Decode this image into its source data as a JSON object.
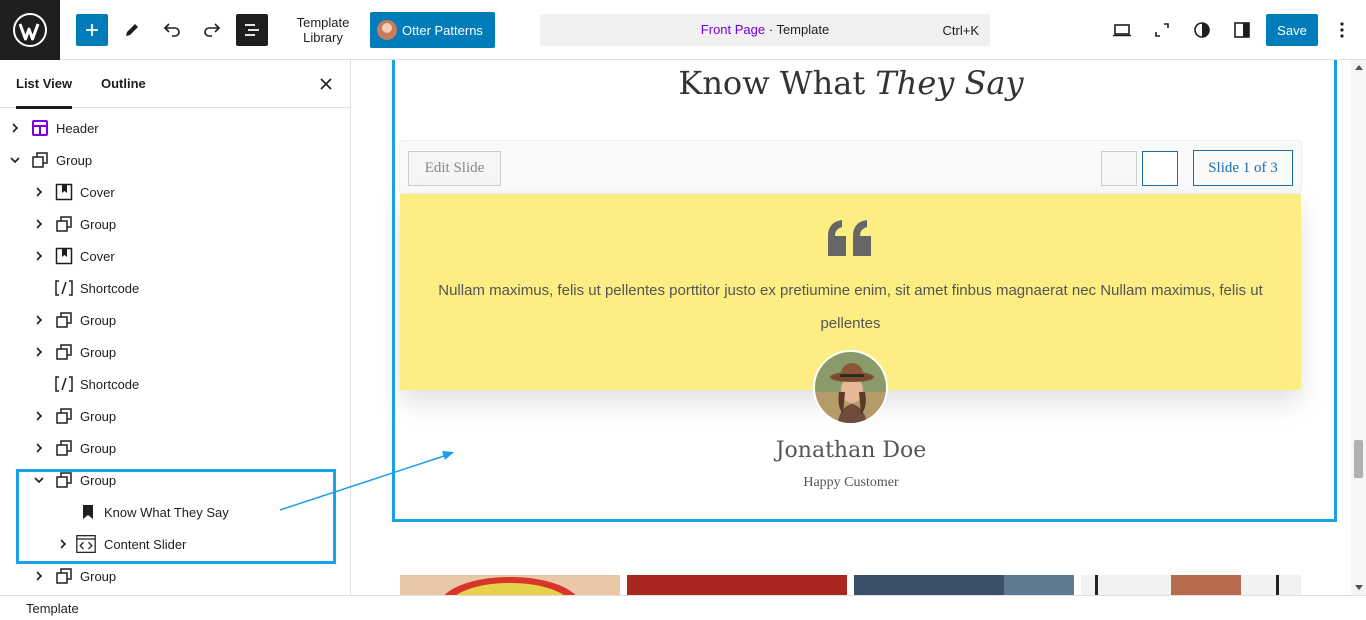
{
  "toolbar": {
    "template_library": "Template\nLibrary",
    "template_library_l1": "Template",
    "template_library_l2": "Library",
    "otter_patterns": "Otter Patterns",
    "command": {
      "front": "Front Page",
      "sep": " · ",
      "type": "Template",
      "shortcut": "Ctrl+K"
    },
    "save": "Save"
  },
  "sidebar": {
    "tabs": [
      "List View",
      "Outline"
    ],
    "items": [
      {
        "label": "Header",
        "icon": "template-part-icon",
        "expander": "collapsed"
      },
      {
        "label": "Group",
        "icon": "group-icon",
        "expander": "expanded"
      },
      {
        "label": "Cover",
        "icon": "cover-icon",
        "expander": "collapsed"
      },
      {
        "label": "Group",
        "icon": "group-icon",
        "expander": "collapsed"
      },
      {
        "label": "Cover",
        "icon": "cover-icon",
        "expander": "collapsed"
      },
      {
        "label": "Shortcode",
        "icon": "shortcode-icon",
        "expander": "none"
      },
      {
        "label": "Group",
        "icon": "group-icon",
        "expander": "collapsed"
      },
      {
        "label": "Group",
        "icon": "group-icon",
        "expander": "collapsed"
      },
      {
        "label": "Shortcode",
        "icon": "shortcode-icon",
        "expander": "none"
      },
      {
        "label": "Group",
        "icon": "group-icon",
        "expander": "collapsed"
      },
      {
        "label": "Group",
        "icon": "group-icon",
        "expander": "collapsed"
      },
      {
        "label": "Group",
        "icon": "group-icon",
        "expander": "expanded"
      },
      {
        "label": "Know What They Say",
        "icon": "bookmark-icon",
        "expander": "none"
      },
      {
        "label": "Content Slider",
        "icon": "slider-icon",
        "expander": "collapsed"
      },
      {
        "label": "Group",
        "icon": "group-icon",
        "expander": "collapsed"
      }
    ]
  },
  "canvas": {
    "heading_plain": "Know What ",
    "heading_italic": "They Say",
    "edit_slide": "Edit Slide",
    "slide_counter": "Slide 1 of 3",
    "quote": "Nullam maximus, felis ut pellentes porttitor justo ex pretiumine enim, sit amet finbus magnaerat nec Nullam maximus, felis ut pellentes",
    "person_name": "Jonathan Doe",
    "person_role": "Happy Customer"
  },
  "footer": {
    "breadcrumb": "Template"
  },
  "colors": {
    "accent": "#007cba",
    "highlight": "#1aa0e6",
    "slide_bg": "#fcee83",
    "front_page": "#7a00df"
  }
}
